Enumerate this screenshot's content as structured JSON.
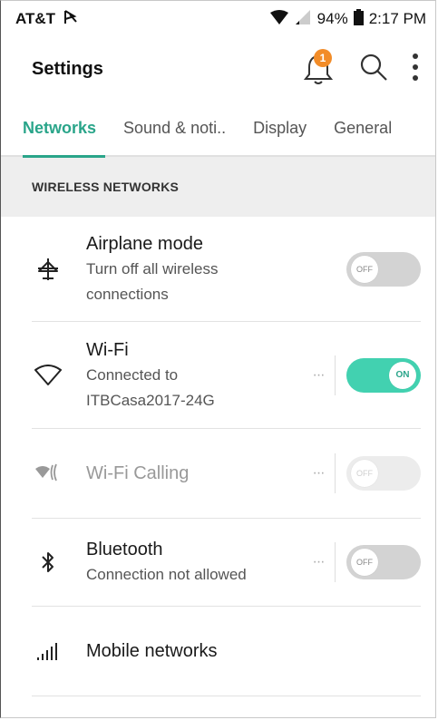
{
  "status_bar": {
    "carrier": "AT&T",
    "battery": "94%",
    "time": "2:17 PM"
  },
  "app_bar": {
    "title": "Settings",
    "notification_count": "1"
  },
  "tabs": [
    {
      "label": "Networks",
      "active": true
    },
    {
      "label": "Sound & noti..",
      "active": false
    },
    {
      "label": "Display",
      "active": false
    },
    {
      "label": "General",
      "active": false
    }
  ],
  "section": {
    "header": "WIRELESS NETWORKS"
  },
  "rows": {
    "airplane": {
      "title": "Airplane mode",
      "sub1": "Turn off all wireless",
      "sub2": "connections",
      "toggle": "OFF",
      "icon": "airplane-icon"
    },
    "wifi": {
      "title": "Wi-Fi",
      "sub1": "Connected to",
      "sub2": "ITBCasa2017-24G",
      "more": "···",
      "toggle": "ON",
      "icon": "wifi-icon"
    },
    "wifi_calling": {
      "title": "Wi-Fi Calling",
      "more": "···",
      "toggle": "OFF",
      "icon": "wifi-calling-icon"
    },
    "bluetooth": {
      "title": "Bluetooth",
      "sub1": "Connection not allowed",
      "more": "···",
      "toggle": "OFF",
      "icon": "bluetooth-icon"
    },
    "mobile": {
      "title": "Mobile networks",
      "icon": "signal-bars-icon"
    }
  },
  "colors": {
    "accent": "#2aa58a",
    "toggle_on": "#42d1b0",
    "badge": "#f28c28"
  }
}
